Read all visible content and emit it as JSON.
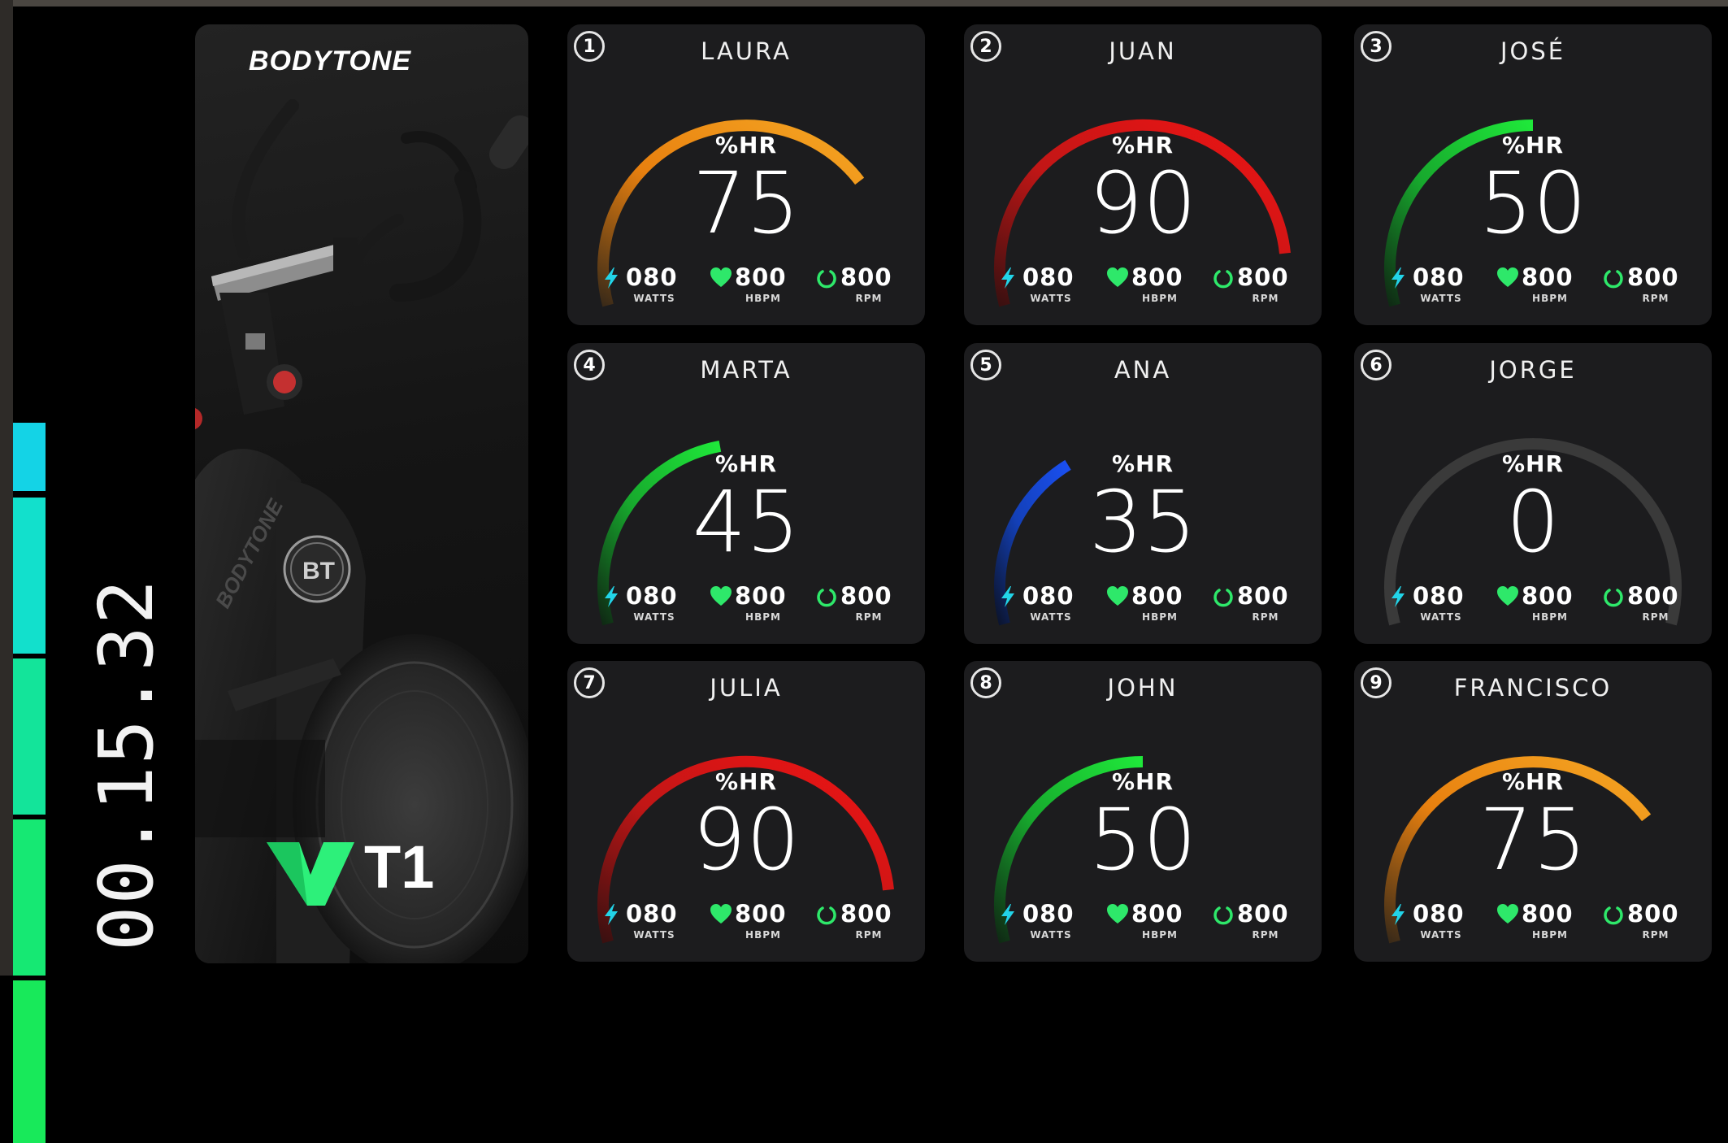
{
  "timer": "00.15.32",
  "brand": "BODYTONE",
  "model": "T1",
  "intensity_bar": {
    "segments": [
      "#14d3e6",
      "#12e0cc",
      "#13e49a",
      "#16e873",
      "#18e95a"
    ]
  },
  "colors": {
    "cyan": "#22d4e8",
    "green": "#2ee86a",
    "card_bg": "#1c1c1e",
    "zone_gradients": {
      "orange": [
        "#3a2a18",
        "#e8800f",
        "#f5a623"
      ],
      "red": [
        "#3a1010",
        "#c21616",
        "#f01414"
      ],
      "green": [
        "#0f2a14",
        "#17a82d",
        "#1fe83a"
      ],
      "blue": [
        "#0c1530",
        "#1340b8",
        "#1a4ff0"
      ],
      "gray": [
        "#3a3a3a",
        "#3a3a3a",
        "#3a3a3a"
      ]
    }
  },
  "cards": [
    {
      "index": "1",
      "name": "LAURA",
      "hr_label": "%HR",
      "hr": "75",
      "fraction": 0.75,
      "zone": "orange",
      "watts": "080",
      "watts_unit": "WATTS",
      "hbpm": "800",
      "hbpm_unit": "HBPM",
      "rpm": "800",
      "rpm_unit": "RPM"
    },
    {
      "index": "2",
      "name": "JUAN",
      "hr_label": "%HR",
      "hr": "90",
      "fraction": 0.9,
      "zone": "red",
      "watts": "080",
      "watts_unit": "WATTS",
      "hbpm": "800",
      "hbpm_unit": "HBPM",
      "rpm": "800",
      "rpm_unit": "RPM"
    },
    {
      "index": "3",
      "name": "JOSÉ",
      "hr_label": "%HR",
      "hr": "50",
      "fraction": 0.5,
      "zone": "green",
      "watts": "080",
      "watts_unit": "WATTS",
      "hbpm": "800",
      "hbpm_unit": "HBPM",
      "rpm": "800",
      "rpm_unit": "RPM"
    },
    {
      "index": "4",
      "name": "MARTA",
      "hr_label": "%HR",
      "hr": "45",
      "fraction": 0.45,
      "zone": "green",
      "watts": "080",
      "watts_unit": "WATTS",
      "hbpm": "800",
      "hbpm_unit": "HBPM",
      "rpm": "800",
      "rpm_unit": "RPM"
    },
    {
      "index": "5",
      "name": "ANA",
      "hr_label": "%HR",
      "hr": "35",
      "fraction": 0.35,
      "zone": "blue",
      "watts": "080",
      "watts_unit": "WATTS",
      "hbpm": "800",
      "hbpm_unit": "HBPM",
      "rpm": "800",
      "rpm_unit": "RPM"
    },
    {
      "index": "6",
      "name": "JORGE",
      "hr_label": "%HR",
      "hr": "0",
      "fraction": 1.0,
      "zone": "gray",
      "watts": "080",
      "watts_unit": "WATTS",
      "hbpm": "800",
      "hbpm_unit": "HBPM",
      "rpm": "800",
      "rpm_unit": "RPM"
    },
    {
      "index": "7",
      "name": "JULIA",
      "hr_label": "%HR",
      "hr": "90",
      "fraction": 0.9,
      "zone": "red",
      "watts": "080",
      "watts_unit": "WATTS",
      "hbpm": "800",
      "hbpm_unit": "HBPM",
      "rpm": "800",
      "rpm_unit": "RPM"
    },
    {
      "index": "8",
      "name": "JOHN",
      "hr_label": "%HR",
      "hr": "50",
      "fraction": 0.5,
      "zone": "green",
      "watts": "080",
      "watts_unit": "WATTS",
      "hbpm": "800",
      "hbpm_unit": "HBPM",
      "rpm": "800",
      "rpm_unit": "RPM"
    },
    {
      "index": "9",
      "name": "FRANCISCO",
      "hr_label": "%HR",
      "hr": "75",
      "fraction": 0.75,
      "zone": "orange",
      "watts": "080",
      "watts_unit": "WATTS",
      "hbpm": "800",
      "hbpm_unit": "HBPM",
      "rpm": "800",
      "rpm_unit": "RPM"
    }
  ],
  "icons": {
    "watts": "lightning-icon",
    "hbpm": "heart-icon",
    "rpm": "rotation-icon"
  }
}
